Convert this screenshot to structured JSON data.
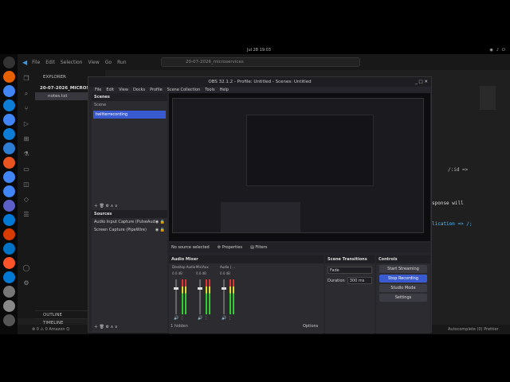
{
  "system": {
    "clock": "Jul 28  19:03",
    "tray": [
      "?",
      "wifi",
      "vol",
      "bat"
    ]
  },
  "dock": {
    "items": [
      "ubuntu",
      "firefox",
      "chrome",
      "edge",
      "chrome",
      "edge",
      "files",
      "app-store",
      "chrome",
      "chrome",
      "teams",
      "vscode",
      "office",
      "outlook",
      "brave",
      "vscode",
      "settings",
      "trash",
      "apps"
    ]
  },
  "vscode": {
    "menu": [
      "File",
      "Edit",
      "Selection",
      "View",
      "Go",
      "Run"
    ],
    "command_center": "20-07-2026_microservices",
    "explorer": {
      "title": "EXPLORER",
      "folder": "20-07-2026_MICROSERV",
      "file": "notes.txt"
    },
    "outline": "OUTLINE",
    "timeline": "TIMELINE",
    "editor_lines": [
      "/:id =>",
      "sponse will",
      "lication => /;"
    ],
    "status_left": "⊗ 0 ⚠ 0   Amazon Q",
    "status_right": "Autocomplete (0)   Prettier"
  },
  "obs": {
    "title": "OBS 32.1.2 - Profile: Untitled - Scenes: Untitled",
    "menu": [
      "File",
      "Edit",
      "View",
      "Docks",
      "Profile",
      "Scene Collection",
      "Tools",
      "Help"
    ],
    "scenes_title": "Scenes",
    "scene_label": "Scene",
    "scene_selected": "twitterrecording",
    "sources_title": "Sources",
    "sources": [
      "Audio Input Capture (PulseAud",
      "Screen Capture (PipeWire)"
    ],
    "no_source": "No source selected",
    "properties": "Properties",
    "filters": "Filters",
    "mixer_title": "Audio Mixer",
    "mixer_channels": [
      "Desktop Audio",
      "Mic/Aux",
      "Audio | ..."
    ],
    "mixer_db": [
      "0.0 dB",
      "0.0 dB",
      "0.0 dB"
    ],
    "transitions_title": "Scene Transitions",
    "transition": "Fade",
    "duration_label": "Duration",
    "duration": "300 ms",
    "controls_title": "Controls",
    "controls": [
      "Start Streaming",
      "Stop Recording",
      "Studio Mode",
      "Settings"
    ],
    "hidden": "1 hidden",
    "options": "Options"
  }
}
